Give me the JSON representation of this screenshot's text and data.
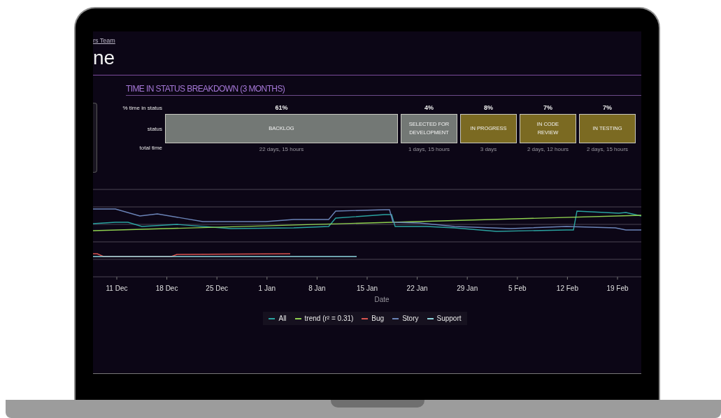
{
  "breadcrumb": "rs Team",
  "page_title": "ne",
  "breakdown": {
    "title": "TIME IN STATUS BREAKDOWN (3 MONTHS)",
    "row_labels": [
      "% time in status",
      "status",
      "total time"
    ],
    "statuses": [
      {
        "percent": "61%",
        "label": "BACKLOG",
        "total": "22 days, 15 hours",
        "color": "#737875"
      },
      {
        "percent": "4%",
        "label": "SELECTED FOR DEVELOPMENT",
        "total": "1 days, 15 hours",
        "color": "#737875"
      },
      {
        "percent": "8%",
        "label": "IN PROGRESS",
        "total": "3 days",
        "color": "#7b6a22"
      },
      {
        "percent": "7%",
        "label": "IN CODE REVIEW",
        "total": "2 days, 12 hours",
        "color": "#7b6a22"
      },
      {
        "percent": "7%",
        "label": "IN TESTING",
        "total": "2 days, 15 hours",
        "color": "#7b6a22"
      }
    ]
  },
  "chart": {
    "xlabel": "Date",
    "xtick_labels": [
      "11 Dec",
      "18 Dec",
      "25 Dec",
      "1 Jan",
      "8 Jan",
      "15 Jan",
      "22 Jan",
      "29 Jan",
      "5 Feb",
      "12 Feb",
      "19 Feb"
    ],
    "legend": [
      {
        "label": "All",
        "color": "#2aa3a0"
      },
      {
        "label": "trend (r² = 0.31)",
        "color": "#8fd14f"
      },
      {
        "label": "Bug",
        "color": "#d9534f"
      },
      {
        "label": "Story",
        "color": "#6b84b8"
      },
      {
        "label": "Support",
        "color": "#8fd8e0"
      }
    ]
  }
}
